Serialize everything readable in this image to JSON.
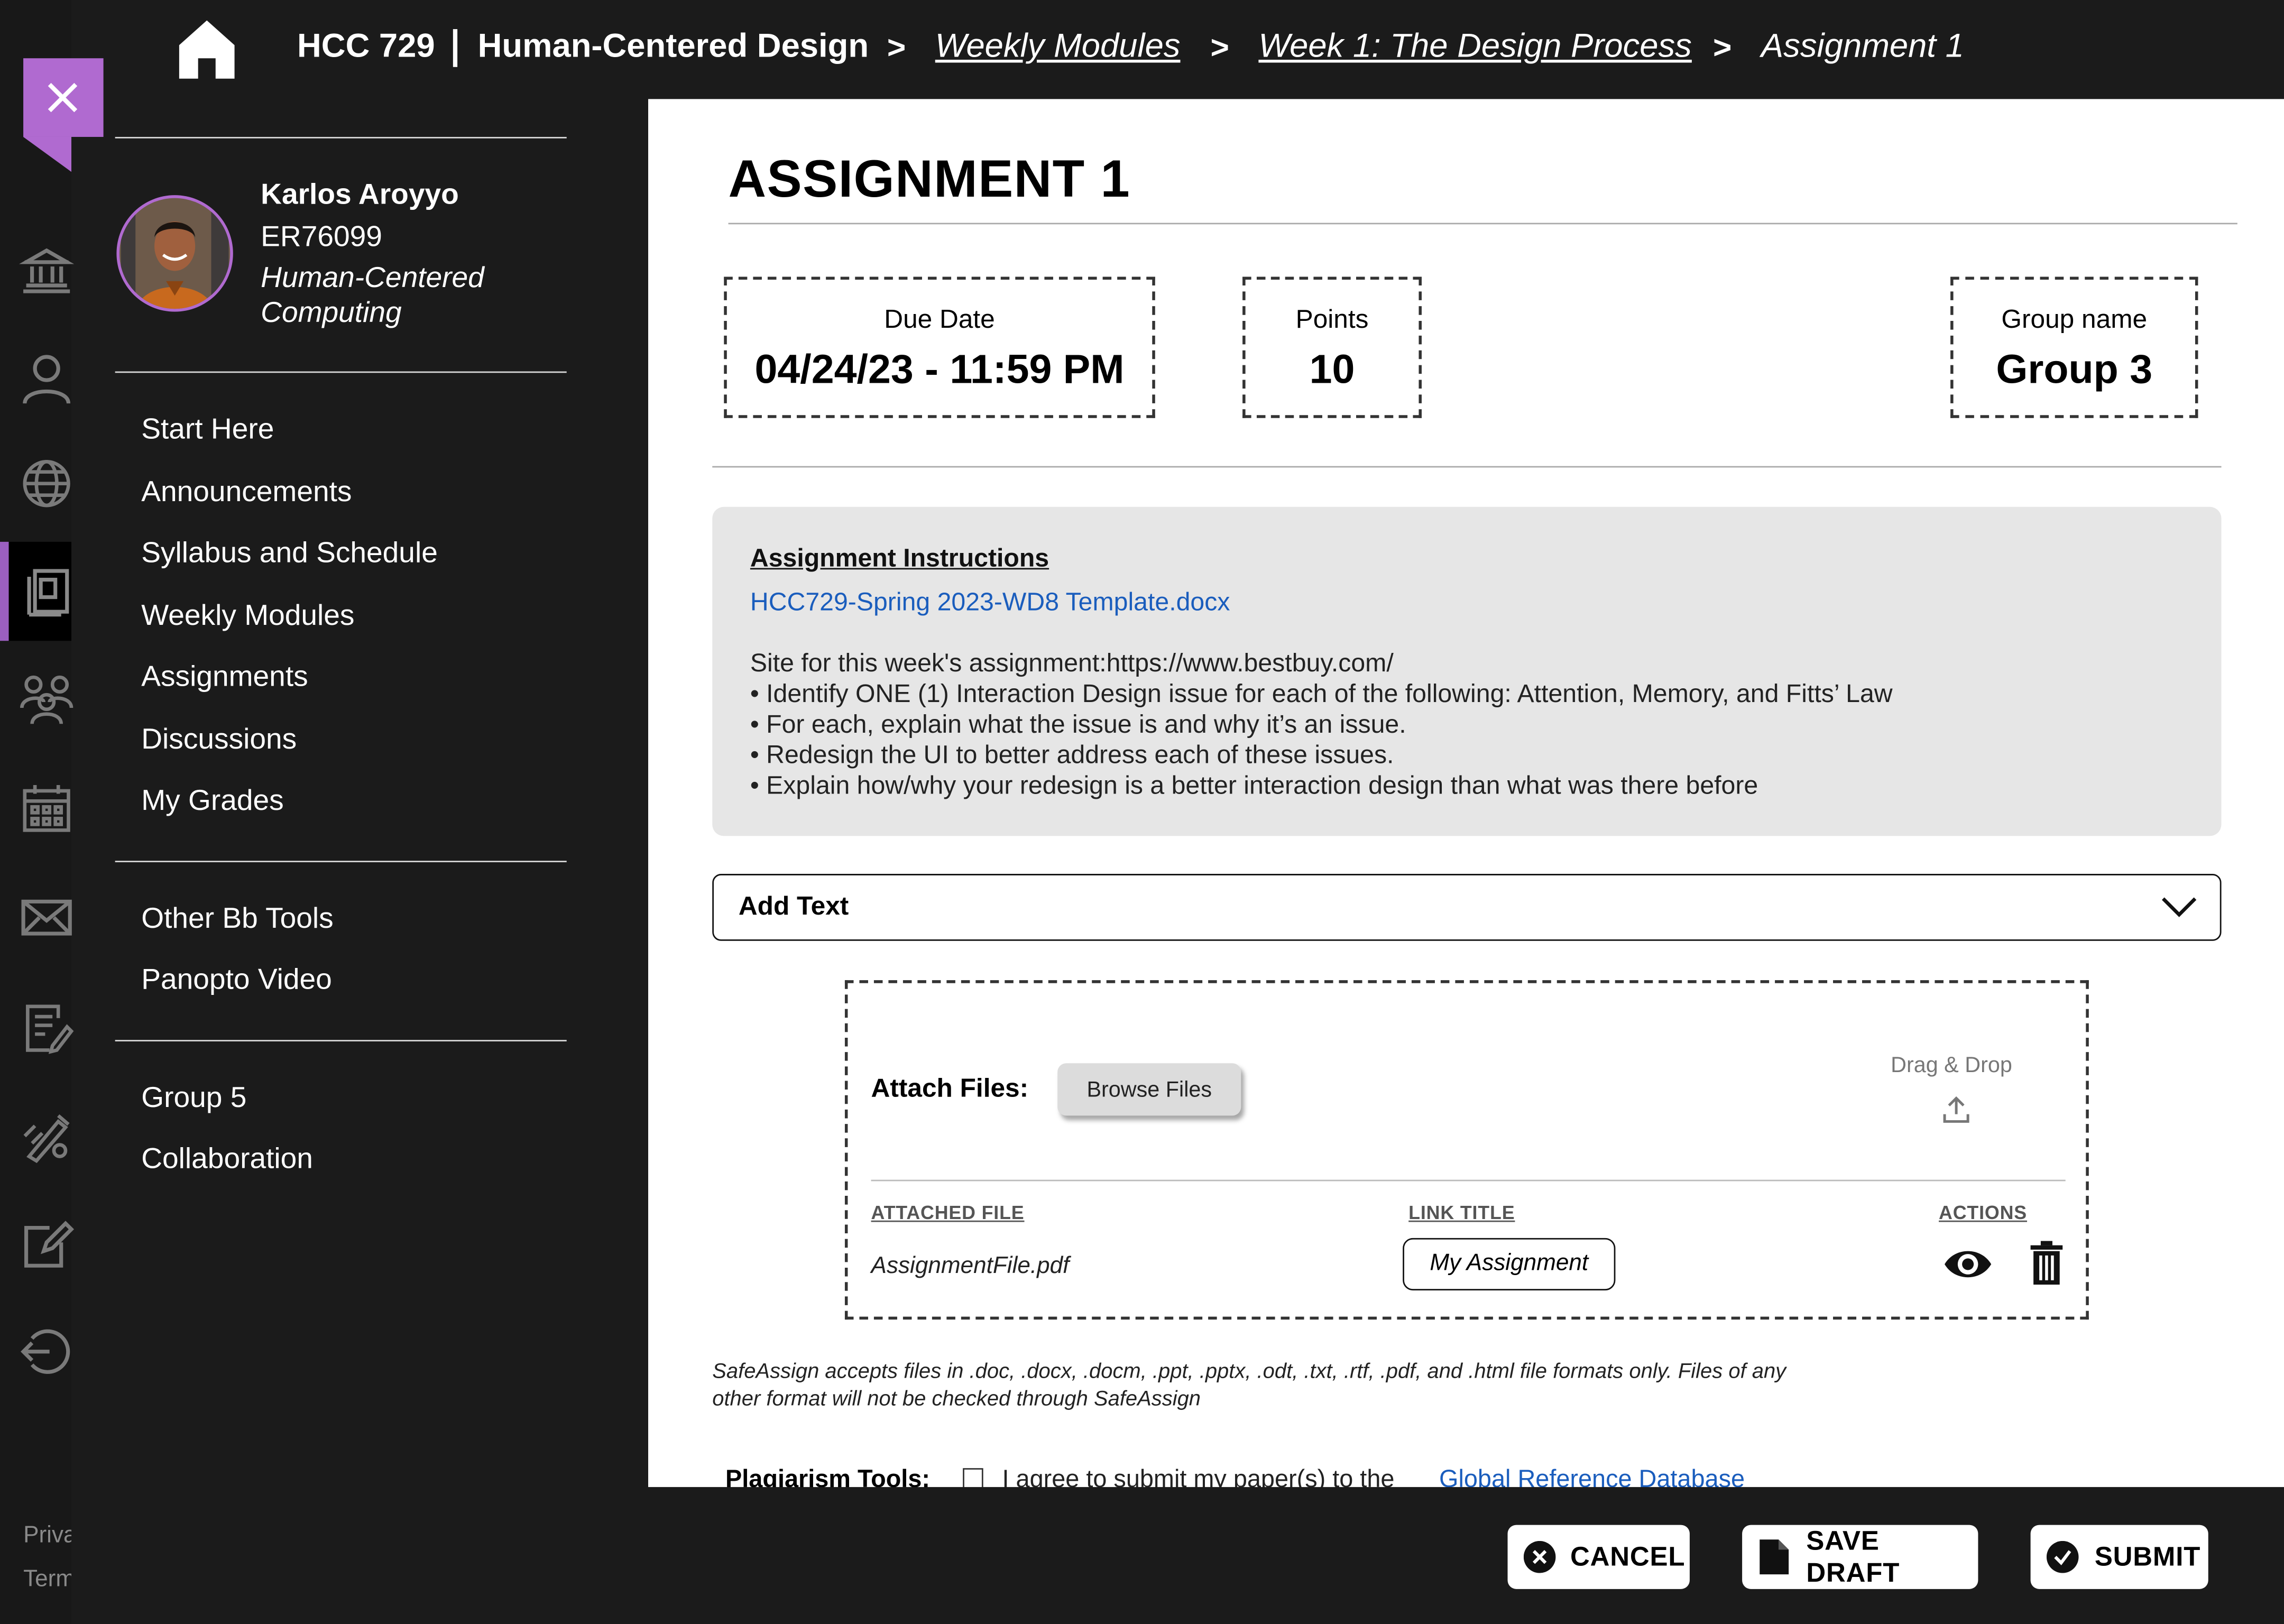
{
  "breadcrumb": {
    "course_code": "HCC 729",
    "course_name": "Human-Centered Design",
    "items": [
      {
        "label": "Weekly Modules",
        "link": true
      },
      {
        "label": "Week 1: The Design Process",
        "link": true
      },
      {
        "label": "Assignment 1",
        "link": false
      }
    ],
    "separator": ">"
  },
  "user": {
    "name": "Karlos Aroyyo",
    "id": "ER76099",
    "program_line1": "Human-Centered",
    "program_line2": "Computing"
  },
  "nav": {
    "group1": [
      "Start Here",
      "Announcements",
      "Syllabus and Schedule",
      "Weekly Modules",
      "Assignments",
      "Discussions",
      "My Grades"
    ],
    "group2": [
      "Other Bb Tools",
      "Panopto Video"
    ],
    "group3": [
      "Group 5",
      "Collaboration"
    ]
  },
  "rail": {
    "icons": [
      "institution-icon",
      "profile-icon",
      "globe-icon",
      "courses-icon",
      "groups-icon",
      "calendar-icon",
      "mail-icon",
      "grades-icon",
      "tools-icon",
      "edit-icon",
      "signout-icon"
    ],
    "active": "courses-icon",
    "footer_1": "Privacy",
    "footer_2": "Terms"
  },
  "assignment": {
    "title": "ASSIGNMENT 1",
    "due_label": "Due Date",
    "due_value": "04/24/23 - 11:59 PM",
    "points_label": "Points",
    "points_value": "10",
    "group_label": "Group name",
    "group_value": "Group 3"
  },
  "instructions": {
    "heading": "Assignment Instructions",
    "file_link": "HCC729-Spring 2023-WD8 Template.docx",
    "site_line": "Site for this week's assignment:https://www.bestbuy.com/",
    "bullets": [
      "• Identify ONE (1) Interaction Design issue for each of the following: Attention, Memory, and Fitts’ Law",
      "• For each, explain what the issue is and why it’s an issue.",
      "• Redesign the UI to better address each of these issues.",
      "• Explain how/why your redesign is a better interaction design than what was there before"
    ]
  },
  "add_text": {
    "label": "Add Text"
  },
  "attach": {
    "label": "Attach Files:",
    "browse_button": "Browse Files",
    "drag_drop": "Drag & Drop",
    "columns": [
      "ATTACHED FILE",
      "LINK TITLE",
      "ACTIONS"
    ],
    "file_name": "AssignmentFile.pdf",
    "link_title": "My Assignment"
  },
  "safeassign": {
    "line1": "SafeAssign accepts files in .doc, .docx, .docm, .ppt, .pptx, .odt, .txt, .rtf, .pdf, and .html file formats only. Files of any",
    "line2": "other format will not be checked through SafeAssign"
  },
  "plagiarism": {
    "label": "Plagiarism Tools:",
    "agree_text": "I agree to submit my paper(s) to the",
    "link": "Global Reference Database",
    "checked": false
  },
  "actions": {
    "cancel": "CANCEL",
    "save_draft": "SAVE DRAFT",
    "submit": "SUBMIT"
  },
  "colors": {
    "accent_purple": "#b06ad0",
    "link_blue": "#1a5dbd",
    "dark_bg": "#1b1b1b"
  }
}
